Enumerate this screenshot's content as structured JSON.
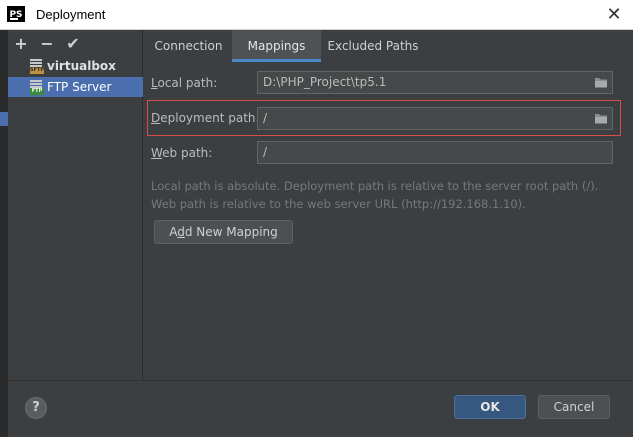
{
  "window": {
    "app_icon_text": "PS",
    "title": "Deployment",
    "close_glyph": "✕"
  },
  "left_toolbar": {
    "add_glyph": "+",
    "remove_glyph": "−",
    "apply_glyph": "✔"
  },
  "servers": [
    {
      "label": "virtualbox",
      "type_tag": "SFTP",
      "selected": false
    },
    {
      "label": "FTP Server",
      "type_tag": "FTP",
      "selected": true
    }
  ],
  "tabs": [
    {
      "label": "Connection",
      "active": false
    },
    {
      "label": "Mappings",
      "active": true
    },
    {
      "label": "Excluded Paths",
      "active": false
    }
  ],
  "mappings": {
    "local_path_label_mnemonic": "L",
    "local_path_label_rest": "ocal path:",
    "local_path_value": "D:\\PHP_Project\\tp5.1",
    "deployment_path_label_mnemonic": "D",
    "deployment_path_label_rest": "eployment path:",
    "deployment_path_value": "/",
    "web_path_label_mnemonic": "W",
    "web_path_label_rest": "eb path:",
    "web_path_value": "/",
    "help_line_1": "Local path is absolute. Deployment path is relative to the server root path (/).",
    "help_line_2": "Web path is relative to the web server URL (http://192.168.1.10).",
    "add_mapping_prefix": "A",
    "add_mapping_mnemonic": "d",
    "add_mapping_rest": "d New Mapping"
  },
  "footer": {
    "help_glyph": "?",
    "ok_label": "OK",
    "cancel_label": "Cancel"
  },
  "colors": {
    "accent": "#4b6eaf",
    "highlight_border": "#d94a4a",
    "ok_button": "#365880"
  }
}
